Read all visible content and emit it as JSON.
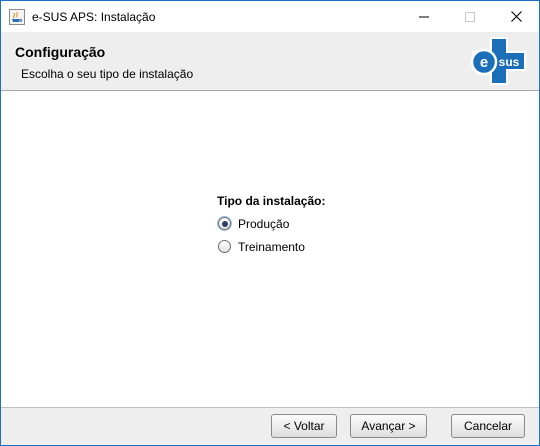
{
  "window": {
    "title": "e-SUS APS: Instalação"
  },
  "header": {
    "title": "Configuração",
    "subtitle": "Escolha o seu tipo de instalação",
    "logo_text": "sus",
    "logo_letter": "e"
  },
  "install_type": {
    "label": "Tipo da instalação:",
    "options": [
      {
        "label": "Produção",
        "selected": true
      },
      {
        "label": "Treinamento",
        "selected": false
      }
    ]
  },
  "footer": {
    "back_label": "< Voltar",
    "next_label": "Avançar >",
    "cancel_label": "Cancelar"
  },
  "icons": {
    "app": "java-cup-icon",
    "minimize": "minimize-icon",
    "maximize": "maximize-icon",
    "close": "close-icon",
    "logo": "esus-logo"
  },
  "colors": {
    "window_border": "#1a73c9",
    "logo_blue": "#1b6fb8",
    "header_bg": "#eeeeee"
  }
}
